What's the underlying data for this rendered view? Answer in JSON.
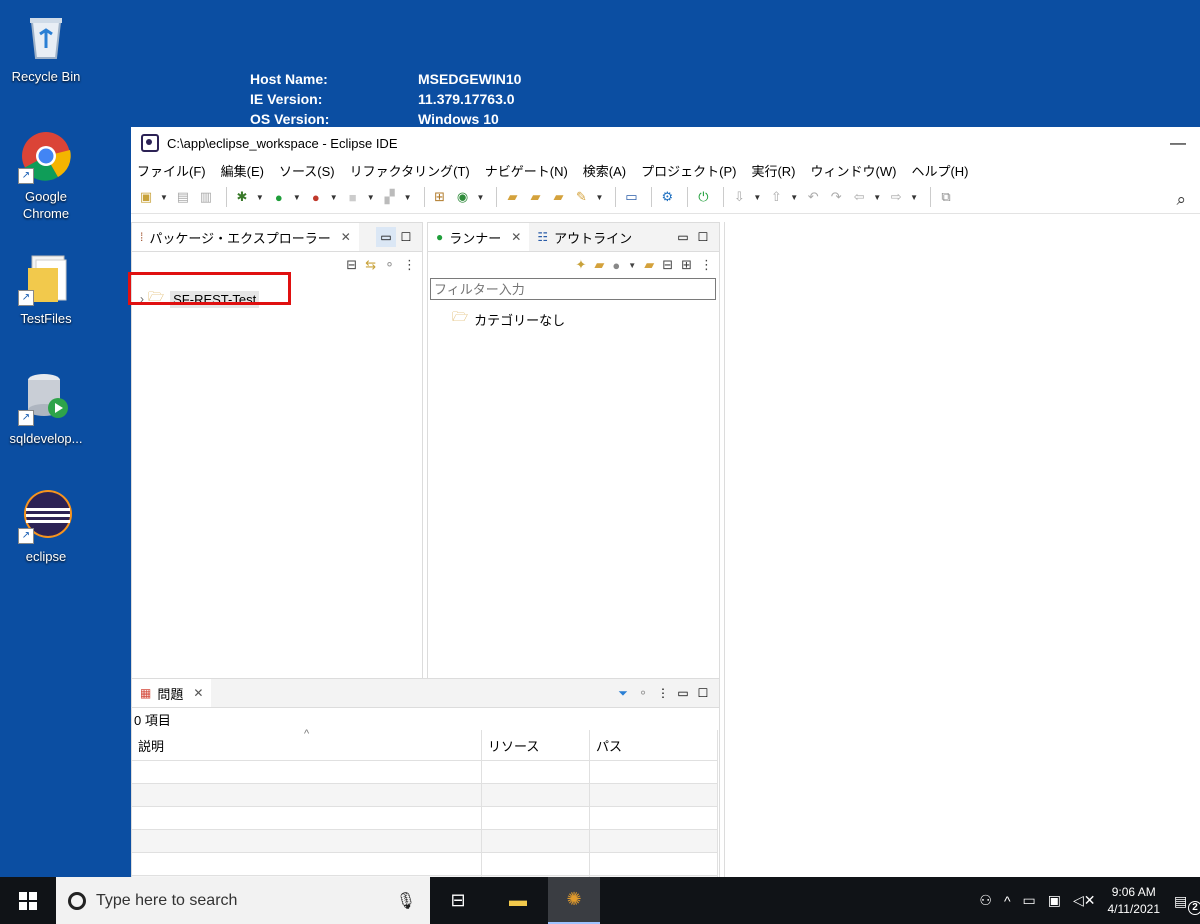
{
  "desktop": {
    "icons": [
      {
        "label": "Recycle Bin"
      },
      {
        "label": "Google\nChrome"
      },
      {
        "label": "TestFiles"
      },
      {
        "label": "sqldevelop..."
      },
      {
        "label": "eclipse"
      }
    ],
    "bginfo": [
      {
        "key": "Host Name:",
        "value": "MSEDGEWIN10"
      },
      {
        "key": "IE Version:",
        "value": "11.379.17763.0"
      },
      {
        "key": "OS Version:",
        "value": "Windows 10"
      }
    ]
  },
  "window": {
    "title": "C:\\app\\eclipse_workspace - Eclipse IDE",
    "minimize": "—",
    "menu": [
      "ファイル(F)",
      "編集(E)",
      "ソース(S)",
      "リファクタリング(T)",
      "ナビゲート(N)",
      "検索(A)",
      "プロジェクト(P)",
      "実行(R)",
      "ウィンドウ(W)",
      "ヘルプ(H)"
    ]
  },
  "package_explorer": {
    "tab_label": "パッケージ・エクスプローラー",
    "project": "SF-REST-Test"
  },
  "runner": {
    "tab_runner": "ランナー",
    "tab_outline": "アウトライン",
    "filter_placeholder": "フィルター入力",
    "category": "カテゴリーなし"
  },
  "problems": {
    "tab_label": "問題",
    "count": "0 項目",
    "columns": [
      "説明",
      "リソース",
      "パス"
    ],
    "sort_indicator": "^"
  },
  "taskbar": {
    "search_placeholder": "Type here to search",
    "time": "9:06 AM",
    "date": "4/11/2021",
    "notifications": "2"
  },
  "colors": {
    "desktop": "#0b4ea2",
    "highlight": "#e01010",
    "taskbar": "#101317"
  }
}
